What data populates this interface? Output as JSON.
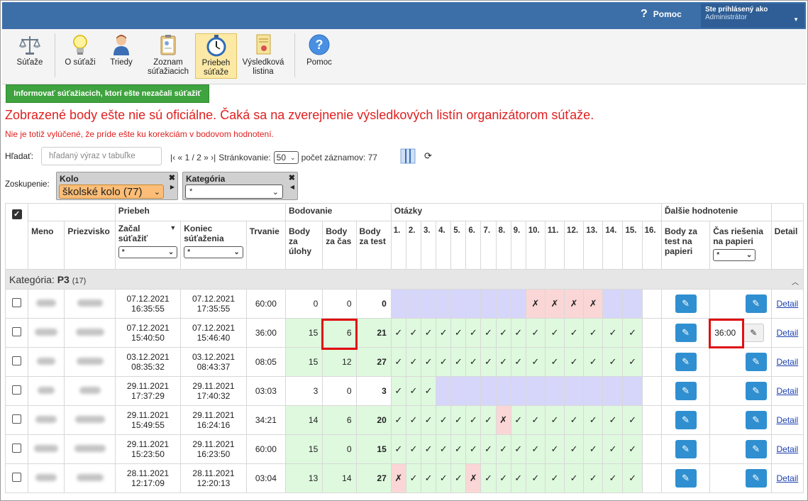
{
  "header": {
    "help_label": "Pomoc",
    "user_line1": "Ste prihlásený ako",
    "user_line2": "Administrátor"
  },
  "toolbar": [
    {
      "label": "Súťaže",
      "icon": "scales-icon",
      "active": false
    },
    {
      "label": "O súťaži",
      "icon": "lightbulb-icon",
      "active": false
    },
    {
      "label": "Triedy",
      "icon": "person-icon",
      "active": false
    },
    {
      "label": "Zoznam súťažiacich",
      "icon": "clipboard-icon",
      "active": false
    },
    {
      "label": "Priebeh súťaže",
      "icon": "stopwatch-icon",
      "active": true
    },
    {
      "label": "Výsledková listina",
      "icon": "certificate-icon",
      "active": false
    },
    {
      "label": "Pomoc",
      "icon": "help-icon",
      "active": false
    }
  ],
  "notify_button": "Informovať súťažiacich, ktorí ešte nezačali súťažiť",
  "warning_main": "Zobrazené body ešte nie sú oficiálne. Čaká sa na zverejnenie výsledkových listín organizátorom súťaže.",
  "warning_sub": "Nie je totiž vylúčené, že príde ešte ku korekciám v bodovom hodnotení.",
  "search": {
    "label": "Hľadať:",
    "placeholder": "hľadaný výraz v tabuľke"
  },
  "pager": {
    "nav": "|‹ « 1 / 2 » ›|",
    "paging_label": "Stránkovanie:",
    "page_size": "50",
    "count_label": "počet záznamov: 77"
  },
  "grouping": {
    "label": "Zoskupenie:",
    "kolo_title": "Kolo",
    "kolo_value": "školské kolo (77)",
    "kategoria_title": "Kategória",
    "kategoria_value": "*"
  },
  "table": {
    "groups": {
      "priebeh": "Priebeh",
      "bodovanie": "Bodovanie",
      "otazky": "Otázky",
      "dalsie": "Ďalšie hodnotenie"
    },
    "headers": {
      "meno": "Meno",
      "priezvisko": "Priezvisko",
      "zacal_1": "Začal",
      "zacal_2": "súťažiť",
      "koniec_1": "Koniec",
      "koniec_2": "súťaženia",
      "trvanie": "Trvanie",
      "body_ulohy_1": "Body",
      "body_ulohy_2": "za",
      "body_ulohy_3": "úlohy",
      "body_cas_1": "Body",
      "body_cas_2": "za čas",
      "body_test_1": "Body",
      "body_test_2": "za test",
      "papier_1": "Body za",
      "papier_2": "test na",
      "papier_3": "papieri",
      "cas_papier_1": "Čas riešenia",
      "cas_papier_2": "na papieri",
      "detail": "Detail",
      "filter_value": "*"
    },
    "questions": [
      "1.",
      "2.",
      "3.",
      "4.",
      "5.",
      "6.",
      "7.",
      "8.",
      "9.",
      "10.",
      "11.",
      "12.",
      "13.",
      "14.",
      "15.",
      "16."
    ],
    "category_prefix": "Kategória:",
    "category_name": "P3",
    "category_count": "(17)",
    "detail_link": "Detail",
    "rows": [
      {
        "start_d": "07.12.2021",
        "start_t": "16:35:55",
        "end_d": "07.12.2021",
        "end_t": "17:35:55",
        "duration": "60:00",
        "b_task": "0",
        "b_time": "0",
        "b_test": "0",
        "row_bg": "w",
        "q": [
          "p",
          "p",
          "p",
          "p",
          "p",
          "p",
          "p",
          "p",
          "p",
          "x",
          "x",
          "x",
          "x",
          "p",
          "p",
          ""
        ],
        "paper_time": ""
      },
      {
        "start_d": "07.12.2021",
        "start_t": "15:40:50",
        "end_d": "07.12.2021",
        "end_t": "15:46:40",
        "duration": "36:00",
        "b_task": "15",
        "b_time": "6",
        "b_test": "21",
        "row_bg": "g",
        "q": [
          "c",
          "c",
          "c",
          "c",
          "c",
          "c",
          "c",
          "c",
          "c",
          "c",
          "c",
          "c",
          "c",
          "c",
          "c",
          ""
        ],
        "paper_time": "36:00"
      },
      {
        "start_d": "03.12.2021",
        "start_t": "08:35:32",
        "end_d": "03.12.2021",
        "end_t": "08:43:37",
        "duration": "08:05",
        "b_task": "15",
        "b_time": "12",
        "b_test": "27",
        "row_bg": "g",
        "q": [
          "c",
          "c",
          "c",
          "c",
          "c",
          "c",
          "c",
          "c",
          "c",
          "c",
          "c",
          "c",
          "c",
          "c",
          "c",
          ""
        ],
        "paper_time": ""
      },
      {
        "start_d": "29.11.2021",
        "start_t": "17:37:29",
        "end_d": "29.11.2021",
        "end_t": "17:40:32",
        "duration": "03:03",
        "b_task": "3",
        "b_time": "0",
        "b_test": "3",
        "row_bg": "w",
        "q": [
          "c",
          "c",
          "c",
          "p",
          "p",
          "p",
          "p",
          "p",
          "p",
          "p",
          "p",
          "p",
          "p",
          "p",
          "p",
          ""
        ],
        "paper_time": ""
      },
      {
        "start_d": "29.11.2021",
        "start_t": "15:49:55",
        "end_d": "29.11.2021",
        "end_t": "16:24:16",
        "duration": "34:21",
        "b_task": "14",
        "b_time": "6",
        "b_test": "20",
        "row_bg": "g",
        "q": [
          "c",
          "c",
          "c",
          "c",
          "c",
          "c",
          "c",
          "x",
          "c",
          "c",
          "c",
          "c",
          "c",
          "c",
          "c",
          ""
        ],
        "paper_time": ""
      },
      {
        "start_d": "29.11.2021",
        "start_t": "15:23:50",
        "end_d": "29.11.2021",
        "end_t": "16:23:50",
        "duration": "60:00",
        "b_task": "15",
        "b_time": "0",
        "b_test": "15",
        "row_bg": "g",
        "q": [
          "c",
          "c",
          "c",
          "c",
          "c",
          "c",
          "c",
          "c",
          "c",
          "c",
          "c",
          "c",
          "c",
          "c",
          "c",
          ""
        ],
        "paper_time": ""
      },
      {
        "start_d": "28.11.2021",
        "start_t": "12:17:09",
        "end_d": "28.11.2021",
        "end_t": "12:20:13",
        "duration": "03:04",
        "b_task": "13",
        "b_time": "14",
        "b_test": "27",
        "row_bg": "g",
        "q": [
          "x",
          "c",
          "c",
          "c",
          "c",
          "x",
          "c",
          "c",
          "c",
          "c",
          "c",
          "c",
          "c",
          "c",
          "c",
          ""
        ],
        "paper_time": ""
      }
    ]
  },
  "colors": {
    "topbar": "#3c6fa8",
    "correct": "#def9de",
    "wrong": "#fbd6d6",
    "pending": "#d6d6fb",
    "highlight": "#e01010"
  }
}
